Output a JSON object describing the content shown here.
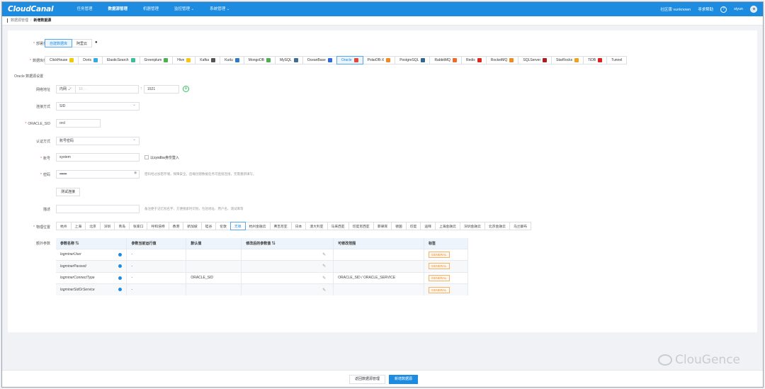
{
  "app": {
    "logo": "CloudCanal"
  },
  "nav": {
    "items": [
      "任务管理",
      "数据源管理",
      "机器管理",
      "监控管理 ⌄",
      "系统管理 ⌄"
    ],
    "active": 1,
    "community": "社区版 vunknown",
    "request_help": "寻求帮助",
    "help_icon": "?",
    "user": "siyun"
  },
  "breadcrumb": {
    "parent": "数据源管理",
    "sep": "/",
    "current": "新增数据源"
  },
  "form": {
    "deploy_type_label": "部署类型",
    "deploy_types": [
      "自建数据库",
      "阿里云"
    ],
    "deploy_selected": 0,
    "ds_type_label": "数据库类型",
    "ds_types": [
      {
        "name": "ClickHouse",
        "color": "#f2c80f"
      },
      {
        "name": "Doris",
        "color": "#3aa7e0"
      },
      {
        "name": "ElasticSearch",
        "color": "#3cbe9b"
      },
      {
        "name": "Greenplum",
        "color": "#4caf50"
      },
      {
        "name": "Hive",
        "color": "#f5c518"
      },
      {
        "name": "Kafka",
        "color": "#555555"
      },
      {
        "name": "Kudu",
        "color": "#2f7bc1"
      },
      {
        "name": "MongoDB",
        "color": "#4caf50"
      },
      {
        "name": "MySQL",
        "color": "#3e6e93"
      },
      {
        "name": "OceanBase",
        "color": "#2c6be0"
      },
      {
        "name": "Oracle",
        "color": "#e0483b"
      },
      {
        "name": "PolarDB-X",
        "color": "#f08a24"
      },
      {
        "name": "PostgreSQL",
        "color": "#336791"
      },
      {
        "name": "RabbitMQ",
        "color": "#f06a24"
      },
      {
        "name": "Redis",
        "color": "#d82c20"
      },
      {
        "name": "RocketMQ",
        "color": "#f08a24"
      },
      {
        "name": "SQLServer",
        "color": "#a91d22"
      },
      {
        "name": "StarRocks",
        "color": "#f0a020"
      },
      {
        "name": "TiDB",
        "color": "#e02020"
      },
      {
        "name": "Tunnel",
        "color": ""
      }
    ],
    "ds_selected": 10,
    "section_title": "Oracle 数据源设置",
    "network_label": "网络地址",
    "network_scope": "内网 ⌄",
    "network_host": "10.  .  .  ",
    "network_colon": ":",
    "network_port": "1521",
    "conn_label": "连接方式",
    "conn_value": "SID",
    "sid_label": "ORACLE_SID",
    "sid_value": "orcl",
    "auth_label": "认证方式",
    "auth_value": "账号密码",
    "account_label": "账号",
    "account_value": "system",
    "sysdba_label": "以sysdba身份登入",
    "password_label": "密码",
    "password_value": "••••••••",
    "password_hint": "密码经过加密存储，保障安全。后端创建数据任务可直接连接，无需重新填写。",
    "test_btn": "测试连接",
    "desc_label": "描述",
    "desc_hint": "备注便于记忆别名字，方便搜索时识别，包括地址、用户名、测试库等",
    "loc_label": "物理位置",
    "locations": [
      "杭州",
      "上海",
      "北京",
      "深圳",
      "青岛",
      "张家口",
      "呼和浩特",
      "香港",
      "新加坡",
      "硅谷",
      "伦敦",
      "无锡",
      "杭州金融云",
      "弗吉尼亚",
      "日本",
      "澳大利亚",
      "马来西亚",
      "印度尼西亚",
      "菲律宾",
      "德国",
      "印度",
      "迪拜",
      "上海金融云",
      "深圳金融云",
      "北京金融云",
      "乌兰察布"
    ],
    "loc_selected": 11,
    "extra_label": "额外参数"
  },
  "params_table": {
    "headers": [
      "参数名称 ⇅",
      "参数当前运行值",
      "默认值",
      "修改后的参数值 ⇅",
      "可修改范围",
      "标签"
    ],
    "rows": [
      {
        "name": "logminerUser",
        "current": "-",
        "default": "",
        "range": "",
        "tag": "GENERAL"
      },
      {
        "name": "logminerPasswd",
        "current": "-",
        "default": "",
        "range": "",
        "tag": "GENERAL"
      },
      {
        "name": "logminerConnectType",
        "current": "-",
        "default": "ORACLE_SID",
        "range": "ORACLE_SID / ORACLE_SERVICE",
        "tag": "GENERAL"
      },
      {
        "name": "logminerSidOrService",
        "current": "-",
        "default": "",
        "range": "",
        "tag": "GENERAL"
      }
    ]
  },
  "footer": {
    "back_btn": "返回数据源管理",
    "submit_btn": "新增数据源"
  },
  "watermark": "ClouGence"
}
